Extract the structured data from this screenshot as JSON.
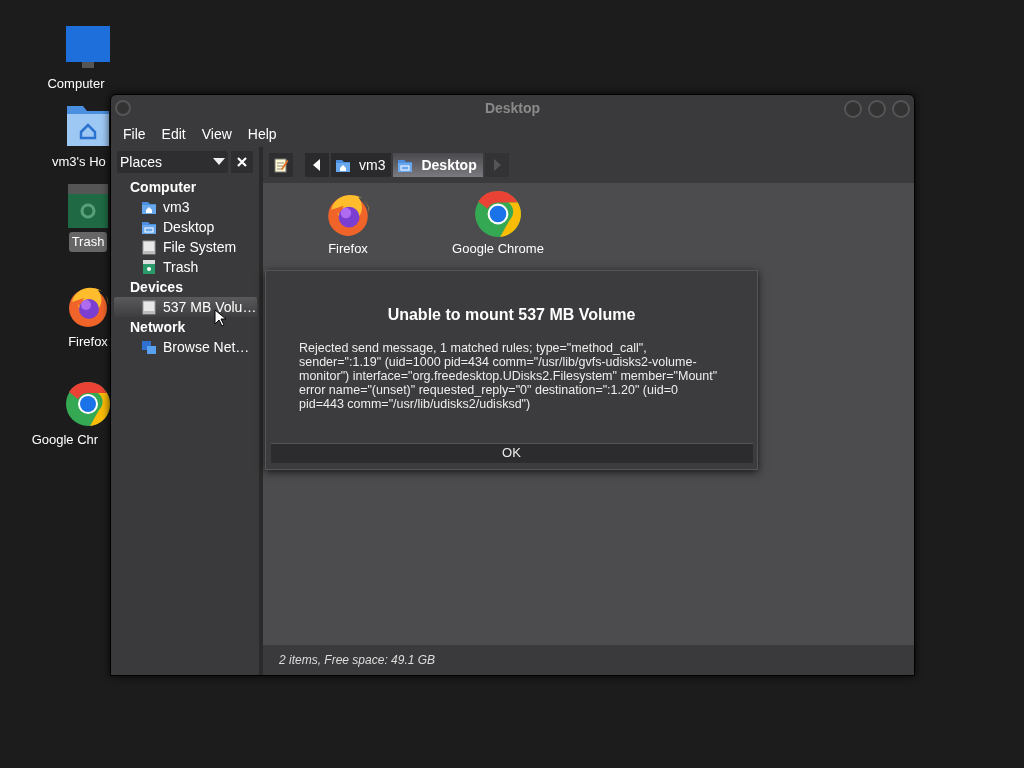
{
  "desktop_icons": [
    {
      "label": "Computer",
      "kind": "monitor",
      "selected": false
    },
    {
      "label": "vm3's Ho",
      "kind": "home",
      "selected": false
    },
    {
      "label": "Trash",
      "kind": "trash",
      "selected": true
    },
    {
      "label": "Firefox",
      "kind": "firefox",
      "selected": false
    },
    {
      "label": "Google Chr",
      "kind": "chrome",
      "selected": false
    }
  ],
  "window": {
    "title": "Desktop"
  },
  "menu": [
    "File",
    "Edit",
    "View",
    "Help"
  ],
  "side_pane": {
    "selector": "Places",
    "sections": [
      {
        "heading": "Computer",
        "items": [
          {
            "label": "vm3",
            "kind": "home",
            "selected": false
          },
          {
            "label": "Desktop",
            "kind": "desktop",
            "selected": false
          },
          {
            "label": "File System",
            "kind": "drive",
            "selected": false
          },
          {
            "label": "Trash",
            "kind": "trash",
            "selected": false
          }
        ]
      },
      {
        "heading": "Devices",
        "items": [
          {
            "label": "537 MB Volu…",
            "kind": "drive",
            "selected": true
          }
        ]
      },
      {
        "heading": "Network",
        "items": [
          {
            "label": "Browse Net…",
            "kind": "network",
            "selected": false
          }
        ]
      }
    ]
  },
  "path_bar": [
    {
      "label": "vm3",
      "kind": "home",
      "selected": false
    },
    {
      "label": "Desktop",
      "kind": "desktop",
      "selected": true
    }
  ],
  "files": [
    {
      "label": "Firefox",
      "kind": "firefox"
    },
    {
      "label": "Google Chrome",
      "kind": "chrome"
    }
  ],
  "status_bar": "2 items, Free space: 49.1 GB",
  "dialog": {
    "title": "Unable to mount 537 MB Volume",
    "message": "Rejected send message, 1 matched rules; type=\"method_call\", sender=\":1.19\" (uid=1000 pid=434 comm=\"/usr/lib/gvfs-udisks2-volume-monitor\") interface=\"org.freedesktop.UDisks2.Filesystem\" member=\"Mount\" error name=\"(unset)\" requested_reply=\"0\" destination=\":1.20\" (uid=0 pid=443 comm=\"/usr/lib/udisks2/udisksd\")",
    "button": "OK"
  }
}
